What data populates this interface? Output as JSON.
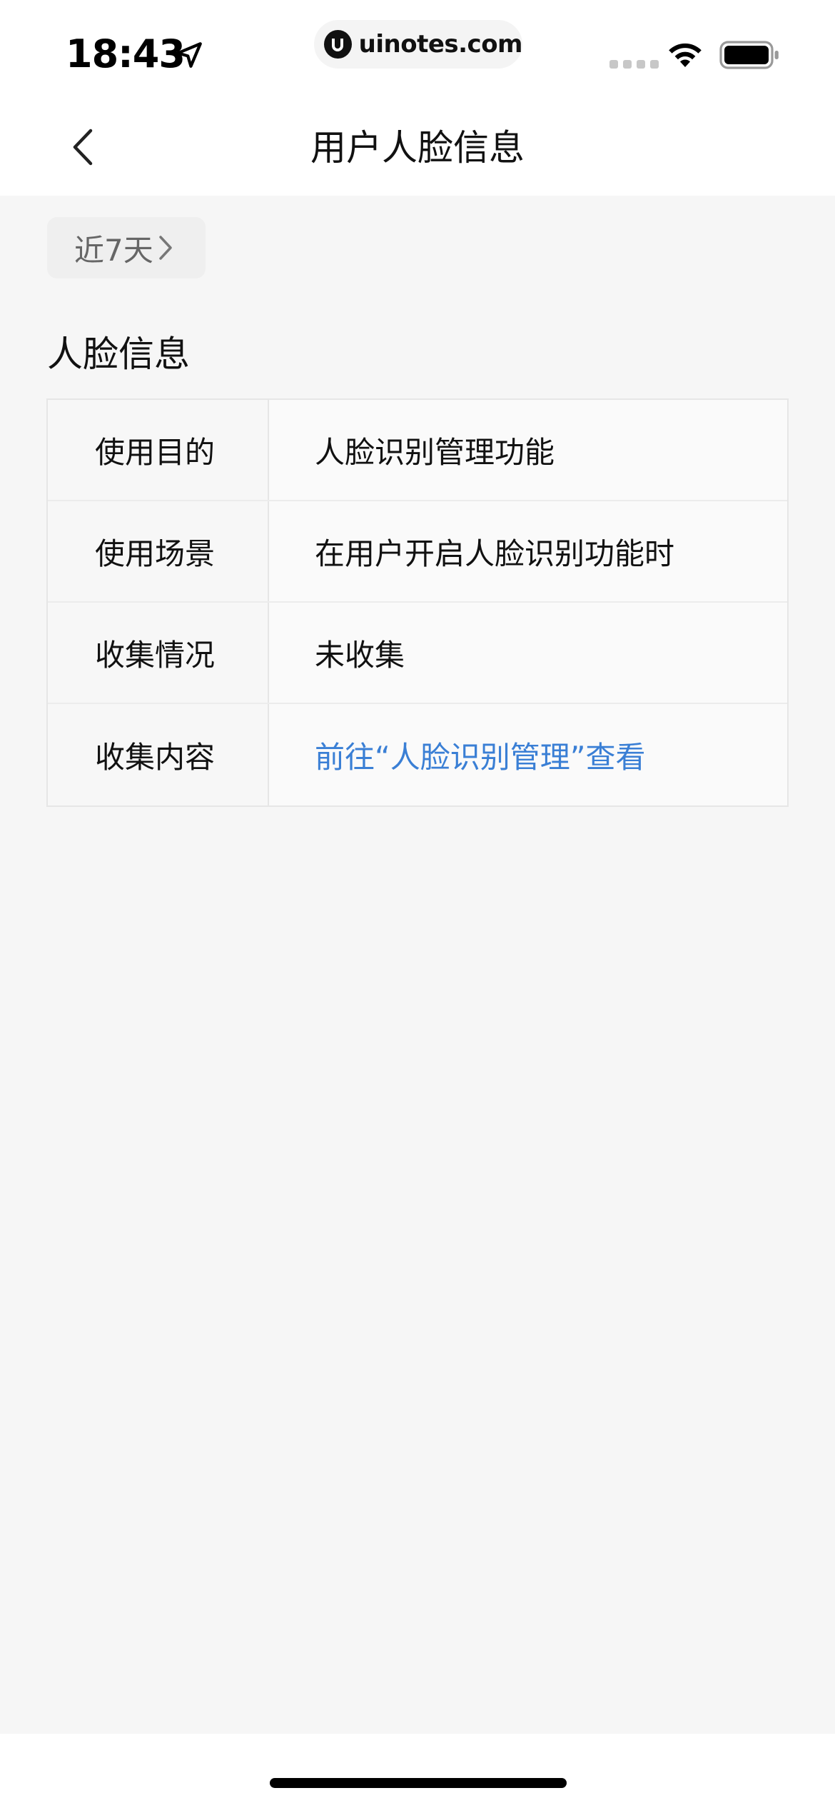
{
  "status_bar": {
    "time": "18:43",
    "url": "uinotes.com",
    "icons": [
      "location-arrow-icon",
      "uinotes-logo-icon",
      "cellular-signal-icon",
      "wifi-icon",
      "battery-icon"
    ]
  },
  "nav": {
    "title": "用户人脸信息",
    "back_icon": "chevron-left-icon"
  },
  "filter": {
    "label": "近7天",
    "icon": "chevron-right-icon"
  },
  "section": {
    "title": "人脸信息"
  },
  "table": {
    "rows": [
      {
        "label": "使用目的",
        "value": "人脸识别管理功能"
      },
      {
        "label": "使用场景",
        "value": "在用户开启人脸识别功能时"
      },
      {
        "label": "收集情况",
        "value": "未收集"
      },
      {
        "label": "收集内容",
        "value": "前往“人脸识别管理”查看"
      }
    ]
  },
  "colors": {
    "link": "#3a7fd5",
    "background": "#f6f6f6"
  }
}
